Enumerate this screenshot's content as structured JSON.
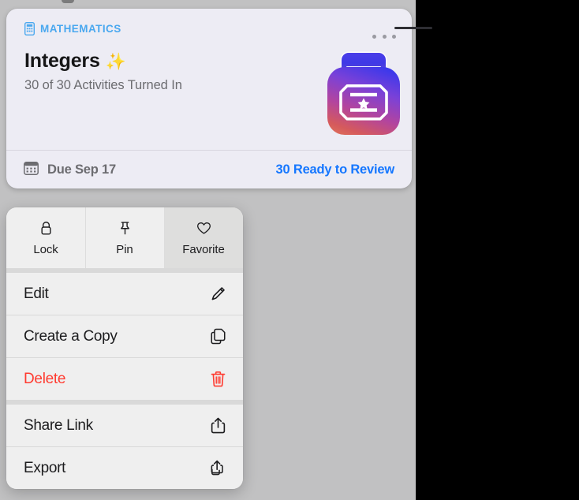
{
  "card": {
    "subject": "MATHEMATICS",
    "subject_icon": "calculator-icon",
    "title": "Integers",
    "title_emoji": "✨",
    "progress_text": "30 of 30 Activities Turned In",
    "more_icon": "ellipsis-icon",
    "thumbnail_icon": "assignment-artwork",
    "due_icon": "calendar-icon",
    "due_text": "Due Sep 17",
    "review_text": "30 Ready to Review",
    "accent_blue": "#1577ff",
    "subject_blue": "#4aa8ef",
    "background": "#edecf4"
  },
  "context_menu": {
    "quick_actions": [
      {
        "label": "Lock",
        "icon": "lock-icon",
        "highlighted": false
      },
      {
        "label": "Pin",
        "icon": "pin-icon",
        "highlighted": false
      },
      {
        "label": "Favorite",
        "icon": "heart-icon",
        "highlighted": true
      }
    ],
    "items": [
      {
        "label": "Edit",
        "icon": "pencil-icon",
        "destructive": false
      },
      {
        "label": "Create a Copy",
        "icon": "duplicate-icon",
        "destructive": false
      },
      {
        "label": "Delete",
        "icon": "trash-icon",
        "destructive": true
      },
      {
        "label": "Share Link",
        "icon": "share-icon",
        "destructive": false
      },
      {
        "label": "Export",
        "icon": "share-multiple-icon",
        "destructive": false
      }
    ],
    "destructive_color": "#ff3b30"
  }
}
